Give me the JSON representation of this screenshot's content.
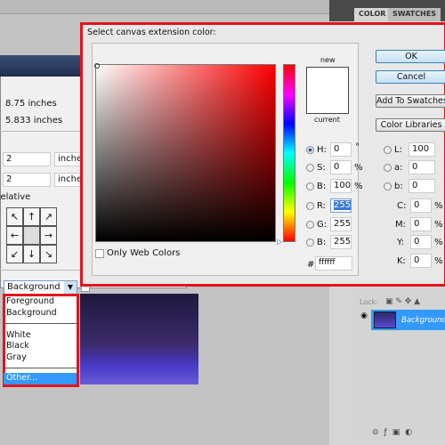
{
  "canvas_size": {
    "width_current": "8.75 inches",
    "height_current": "5.833 inches",
    "width_new": "2",
    "height_new": "2",
    "unit": "inches",
    "relative_label": "Relative",
    "extension_color": "Background"
  },
  "dropdown_menu": {
    "items": [
      "Foreground",
      "Background",
      "White",
      "Black",
      "Gray",
      "Other..."
    ],
    "selected": "Other..."
  },
  "panel_tabs": [
    "COLOR",
    "SWATCHES"
  ],
  "color_picker": {
    "title": "Select canvas extension color:",
    "new_label": "new",
    "current_label": "current",
    "ok": "OK",
    "cancel": "Cancel",
    "add_swatches": "Add To Swatches",
    "color_libraries": "Color Libraries",
    "only_web_colors": "Only Web Colors",
    "fields": {
      "H": "0",
      "S": "0",
      "B": "100",
      "R": "255",
      "G": "255",
      "Bv": "255",
      "L": "100",
      "a": "0",
      "b": "0",
      "C": "0",
      "M": "0",
      "Y": "0",
      "K": "0",
      "hex": "ffffff"
    },
    "units": {
      "deg": "°",
      "pct": "%"
    },
    "labels": {
      "H": "H:",
      "S": "S:",
      "B": "B:",
      "R": "R:",
      "G": "G:",
      "Bv": "B:",
      "L": "L:",
      "a": "a:",
      "b": "b:",
      "C": "C:",
      "M": "M:",
      "Y": "Y:",
      "K": "K:",
      "hex": "#"
    },
    "new_color": "#ffffff",
    "accent": "#e3141c"
  },
  "layers": {
    "locks_label": "Lock:",
    "layer_name": "Background",
    "selected_color": "#3399ff"
  }
}
